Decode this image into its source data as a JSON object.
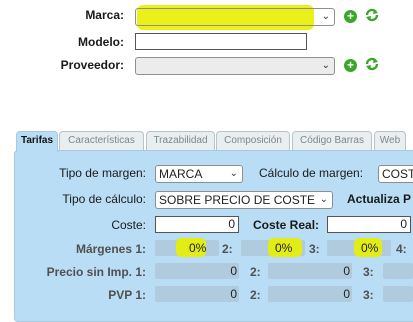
{
  "header": {
    "marca_label": "Marca:",
    "marca_value": "",
    "modelo_label": "Modelo:",
    "modelo_value": "",
    "proveedor_label": "Proveedor:",
    "proveedor_value": ""
  },
  "tabs": [
    {
      "label": "Tarifas",
      "active": true
    },
    {
      "label": "Características"
    },
    {
      "label": "Trazabilidad"
    },
    {
      "label": "Composición"
    },
    {
      "label": "Código Barras"
    },
    {
      "label": "Web"
    }
  ],
  "form": {
    "tipo_margen_label": "Tipo de margen:",
    "tipo_margen_value": "MARCA",
    "calculo_margen_label": "Cálculo de margen:",
    "calculo_margen_value": "COST",
    "tipo_calculo_label": "Tipo de cálculo:",
    "tipo_calculo_value": "SOBRE PRECIO DE COSTE",
    "actualiza_label": "Actualiza P",
    "coste_label": "Coste:",
    "coste_value": "0",
    "coste_real_label": "Coste Real:",
    "coste_real_value": "0",
    "margenes_label": "Márgenes 1:",
    "margen1_value": "0%",
    "m2_label": "2:",
    "margen2_value": "0%",
    "m3_label": "3:",
    "margen3_value": "0%",
    "m4_label": "4:",
    "precio_label": "Precio sin Imp. 1:",
    "precio1_value": "0",
    "p2_label": "2:",
    "precio2_value": "0",
    "p3_label": "3:",
    "pvp_label": "PVP 1:",
    "pvp1_value": "0",
    "v2_label": "2:",
    "pvp2_value": "0",
    "v3_label": "3:"
  },
  "icons": {
    "add": "plus-circle-icon",
    "refresh": "refresh-icon",
    "dropdown": "chevron-down-icon"
  },
  "colors": {
    "highlight": "#e8ef00",
    "panel": "#b9ddf4",
    "green_icon": "#39a829"
  }
}
